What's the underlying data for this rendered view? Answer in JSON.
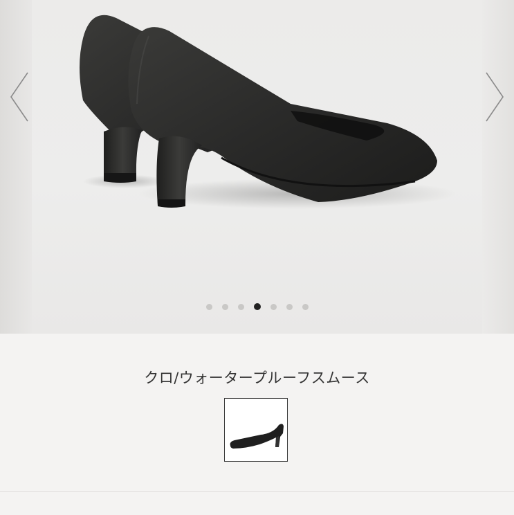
{
  "gallery": {
    "image": {
      "icon": "black-leather-pumps-photo"
    },
    "prev_icon": "chevron-left-icon",
    "next_icon": "chevron-right-icon",
    "slide_count": 7,
    "active_slide": 4
  },
  "product": {
    "color_name": "クロ/ウォータープルーフスムース",
    "swatch": {
      "icon": "black-pump-thumbnail"
    }
  },
  "colors": {
    "background": "#f4f3f2",
    "active_dot": "#222222",
    "inactive_dot": "#c9c8c6",
    "swatch_border": "#3a3a3a"
  }
}
